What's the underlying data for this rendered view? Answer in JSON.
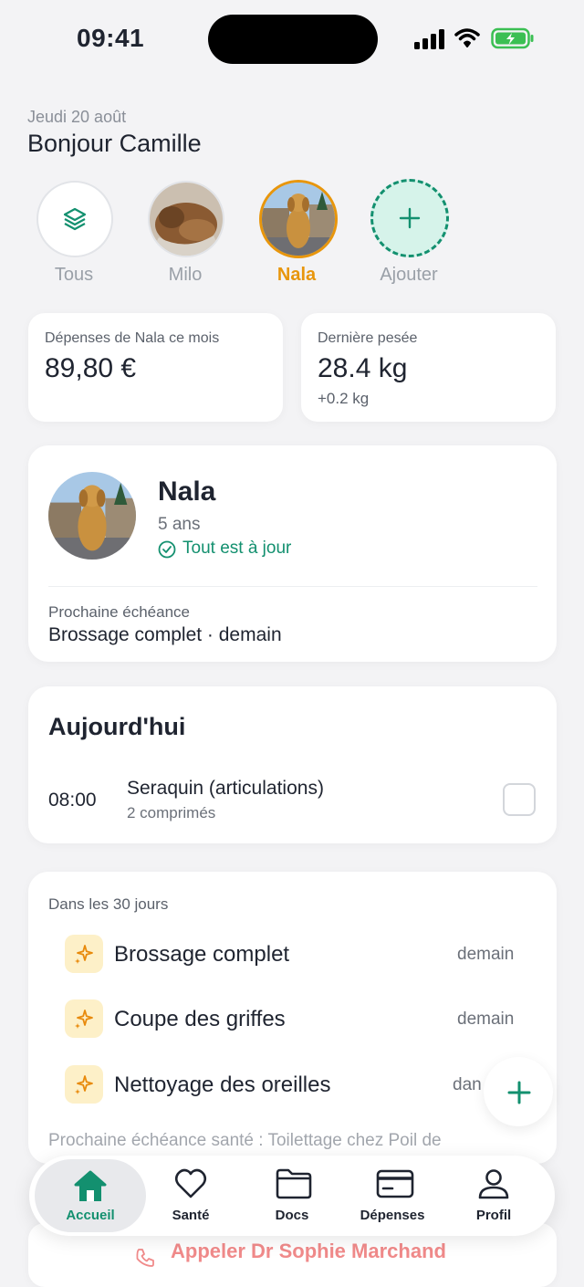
{
  "status": {
    "time": "09:41"
  },
  "header": {
    "date": "Jeudi 20 août",
    "greeting": "Bonjour Camille"
  },
  "pets": [
    {
      "label": "Tous",
      "icon": "layers-icon"
    },
    {
      "label": "Milo",
      "icon": "cat-photo"
    },
    {
      "label": "Nala",
      "icon": "dog-photo",
      "selected": true
    },
    {
      "label": "Ajouter",
      "icon": "plus-icon"
    }
  ],
  "stats": {
    "expenses": {
      "label": "Dépenses de Nala ce mois",
      "value": "89,80 €"
    },
    "weight": {
      "label": "Dernière pesée",
      "value": "28.4 kg",
      "delta": "+0.2 kg"
    }
  },
  "profile": {
    "name": "Nala",
    "age": "5 ans",
    "status": "Tout est à jour",
    "next_label": "Prochaine échéance",
    "next_value": "Brossage complet · demain"
  },
  "today": {
    "title": "Aujourd'hui",
    "items": [
      {
        "time": "08:00",
        "name": "Seraquin (articulations)",
        "detail": "2 comprimés"
      }
    ]
  },
  "upcoming": {
    "title": "Dans les 30 jours",
    "items": [
      {
        "name": "Brossage complet",
        "when": "demain"
      },
      {
        "name": "Coupe des griffes",
        "when": "demain"
      },
      {
        "name": "Nettoyage des oreilles",
        "when": "dan"
      }
    ],
    "footer": "Prochaine échéance santé : Toilettage chez Poil de"
  },
  "call": {
    "label": "Appeler Dr Sophie Marchand"
  },
  "nav": [
    {
      "label": "Accueil",
      "icon": "home-icon",
      "active": true
    },
    {
      "label": "Santé",
      "icon": "heart-icon"
    },
    {
      "label": "Docs",
      "icon": "folder-icon"
    },
    {
      "label": "Dépenses",
      "icon": "card-icon"
    },
    {
      "label": "Profil",
      "icon": "user-icon"
    }
  ],
  "colors": {
    "accent": "#13906f",
    "selected": "#e8960c",
    "mint": "#d6f3ea",
    "task_bg": "#fdf0c8",
    "call": "#f08a8a"
  }
}
